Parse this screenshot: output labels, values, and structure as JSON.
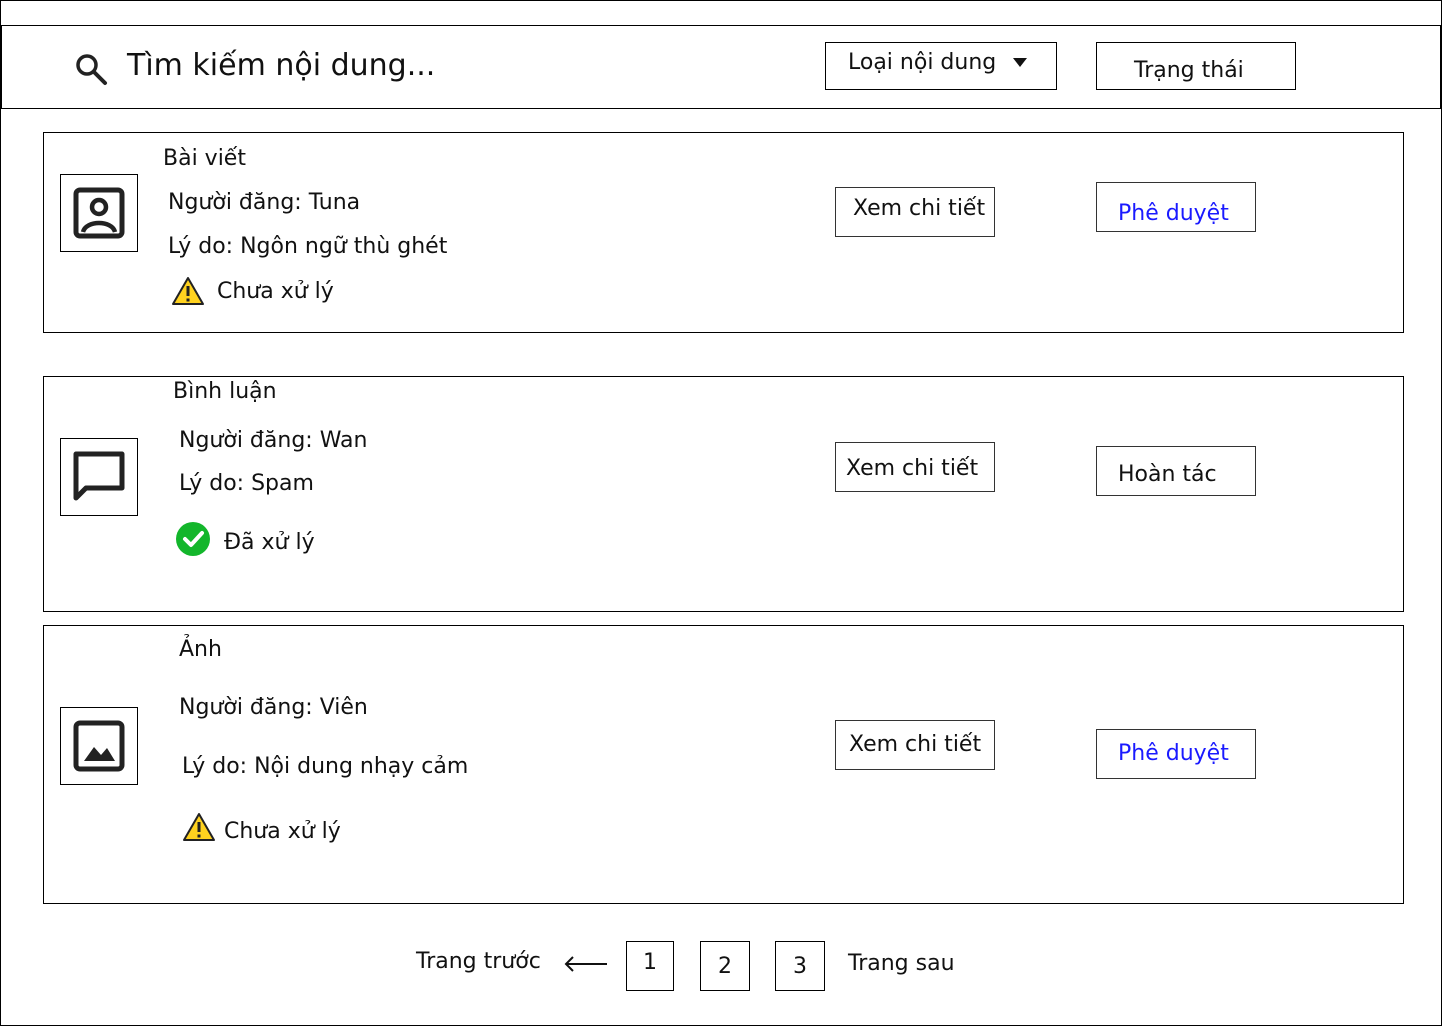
{
  "search": {
    "placeholder": "Tìm kiếm nội dung..."
  },
  "filters": {
    "type_label": "Loại nội dung",
    "status_label": "Trạng thái"
  },
  "items": [
    {
      "type": "Bài viết",
      "poster": "Người đăng: Tuna",
      "reason": "Lý do: Ngôn ngữ thù ghét",
      "status": "Chưa xử lý",
      "status_icon": "warning-icon",
      "thumb_icon": "user-portrait-icon",
      "detail_label": "Xem chi tiết",
      "action_label": "Phê duyệt",
      "action_color": "#1a1aff"
    },
    {
      "type": "Bình luận",
      "poster": "Người đăng: Wan",
      "reason": "Lý do: Spam",
      "status": "Đã xử lý",
      "status_icon": "check-circle-icon",
      "status_color": "#13b62b",
      "thumb_icon": "comment-icon",
      "detail_label": "Xem chi tiết",
      "action_label": "Hoàn tác"
    },
    {
      "type": "Ảnh",
      "poster": "Người đăng: Viên",
      "reason": "Lý do: Nội dung nhạy cảm",
      "status": "Chưa xử lý",
      "status_icon": "warning-icon",
      "thumb_icon": "image-icon",
      "detail_label": "Xem chi tiết",
      "action_label": "Phê duyệt",
      "action_color": "#1a1aff"
    }
  ],
  "pagination": {
    "prev_label": "Trang trước",
    "pages": [
      "1",
      "2",
      "3"
    ],
    "next_label": "Trang sau"
  }
}
